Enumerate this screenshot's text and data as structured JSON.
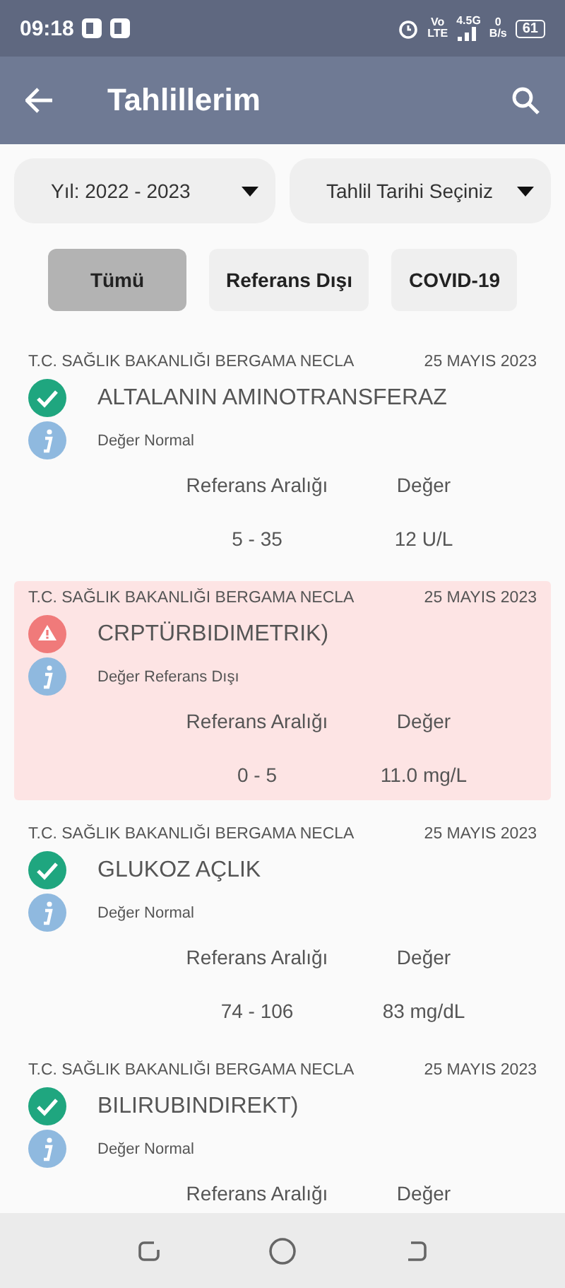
{
  "status_bar": {
    "time": "09:18",
    "volte_top": "Vo",
    "volte_bottom": "LTE",
    "network": "4.5G",
    "speed_value": "0",
    "speed_unit": "B/s",
    "battery": "61"
  },
  "app_bar": {
    "title": "Tahlillerim"
  },
  "filters": [
    {
      "label": "Yıl: 2022 - 2023"
    },
    {
      "label": "Tahlil Tarihi Seçiniz"
    }
  ],
  "chips": [
    {
      "label": "Tümü",
      "selected": true
    },
    {
      "label": "Referans Dışı",
      "selected": false
    },
    {
      "label": "COVID-19",
      "selected": false
    }
  ],
  "results": [
    {
      "institution": "T.C. SAĞLIK BAKANLIĞI BERGAMA NECLA",
      "date": "25 MAYIS 2023",
      "test": "ALTALANIN AMINOTRANSFERAZ",
      "kind": "normal",
      "status_text": "Değer Normal",
      "range_label": "Referans Aralığı",
      "value_label": "Değer",
      "range": "5 - 35",
      "value": "12 U/L"
    },
    {
      "institution": "T.C. SAĞLIK BAKANLIĞI BERGAMA NECLA",
      "date": "25 MAYIS 2023",
      "test": "CRPTÜRBIDIMETRIK)",
      "kind": "out_of_range",
      "status_text": "Değer Referans Dışı",
      "range_label": "Referans Aralığı",
      "value_label": "Değer",
      "range": "0 - 5",
      "value": "11.0 mg/L"
    },
    {
      "institution": "T.C. SAĞLIK BAKANLIĞI BERGAMA NECLA",
      "date": "25 MAYIS 2023",
      "test": "GLUKOZ AÇLIK",
      "kind": "normal",
      "status_text": "Değer Normal",
      "range_label": "Referans Aralığı",
      "value_label": "Değer",
      "range": "74 - 106",
      "value": "83 mg/dL"
    },
    {
      "institution": "T.C. SAĞLIK BAKANLIĞI BERGAMA NECLA",
      "date": "25 MAYIS 2023",
      "test": "BILIRUBINDIREKT)",
      "kind": "normal",
      "status_text": "Değer Normal",
      "range_label": "Referans Aralığı",
      "value_label": "Değer"
    }
  ]
}
